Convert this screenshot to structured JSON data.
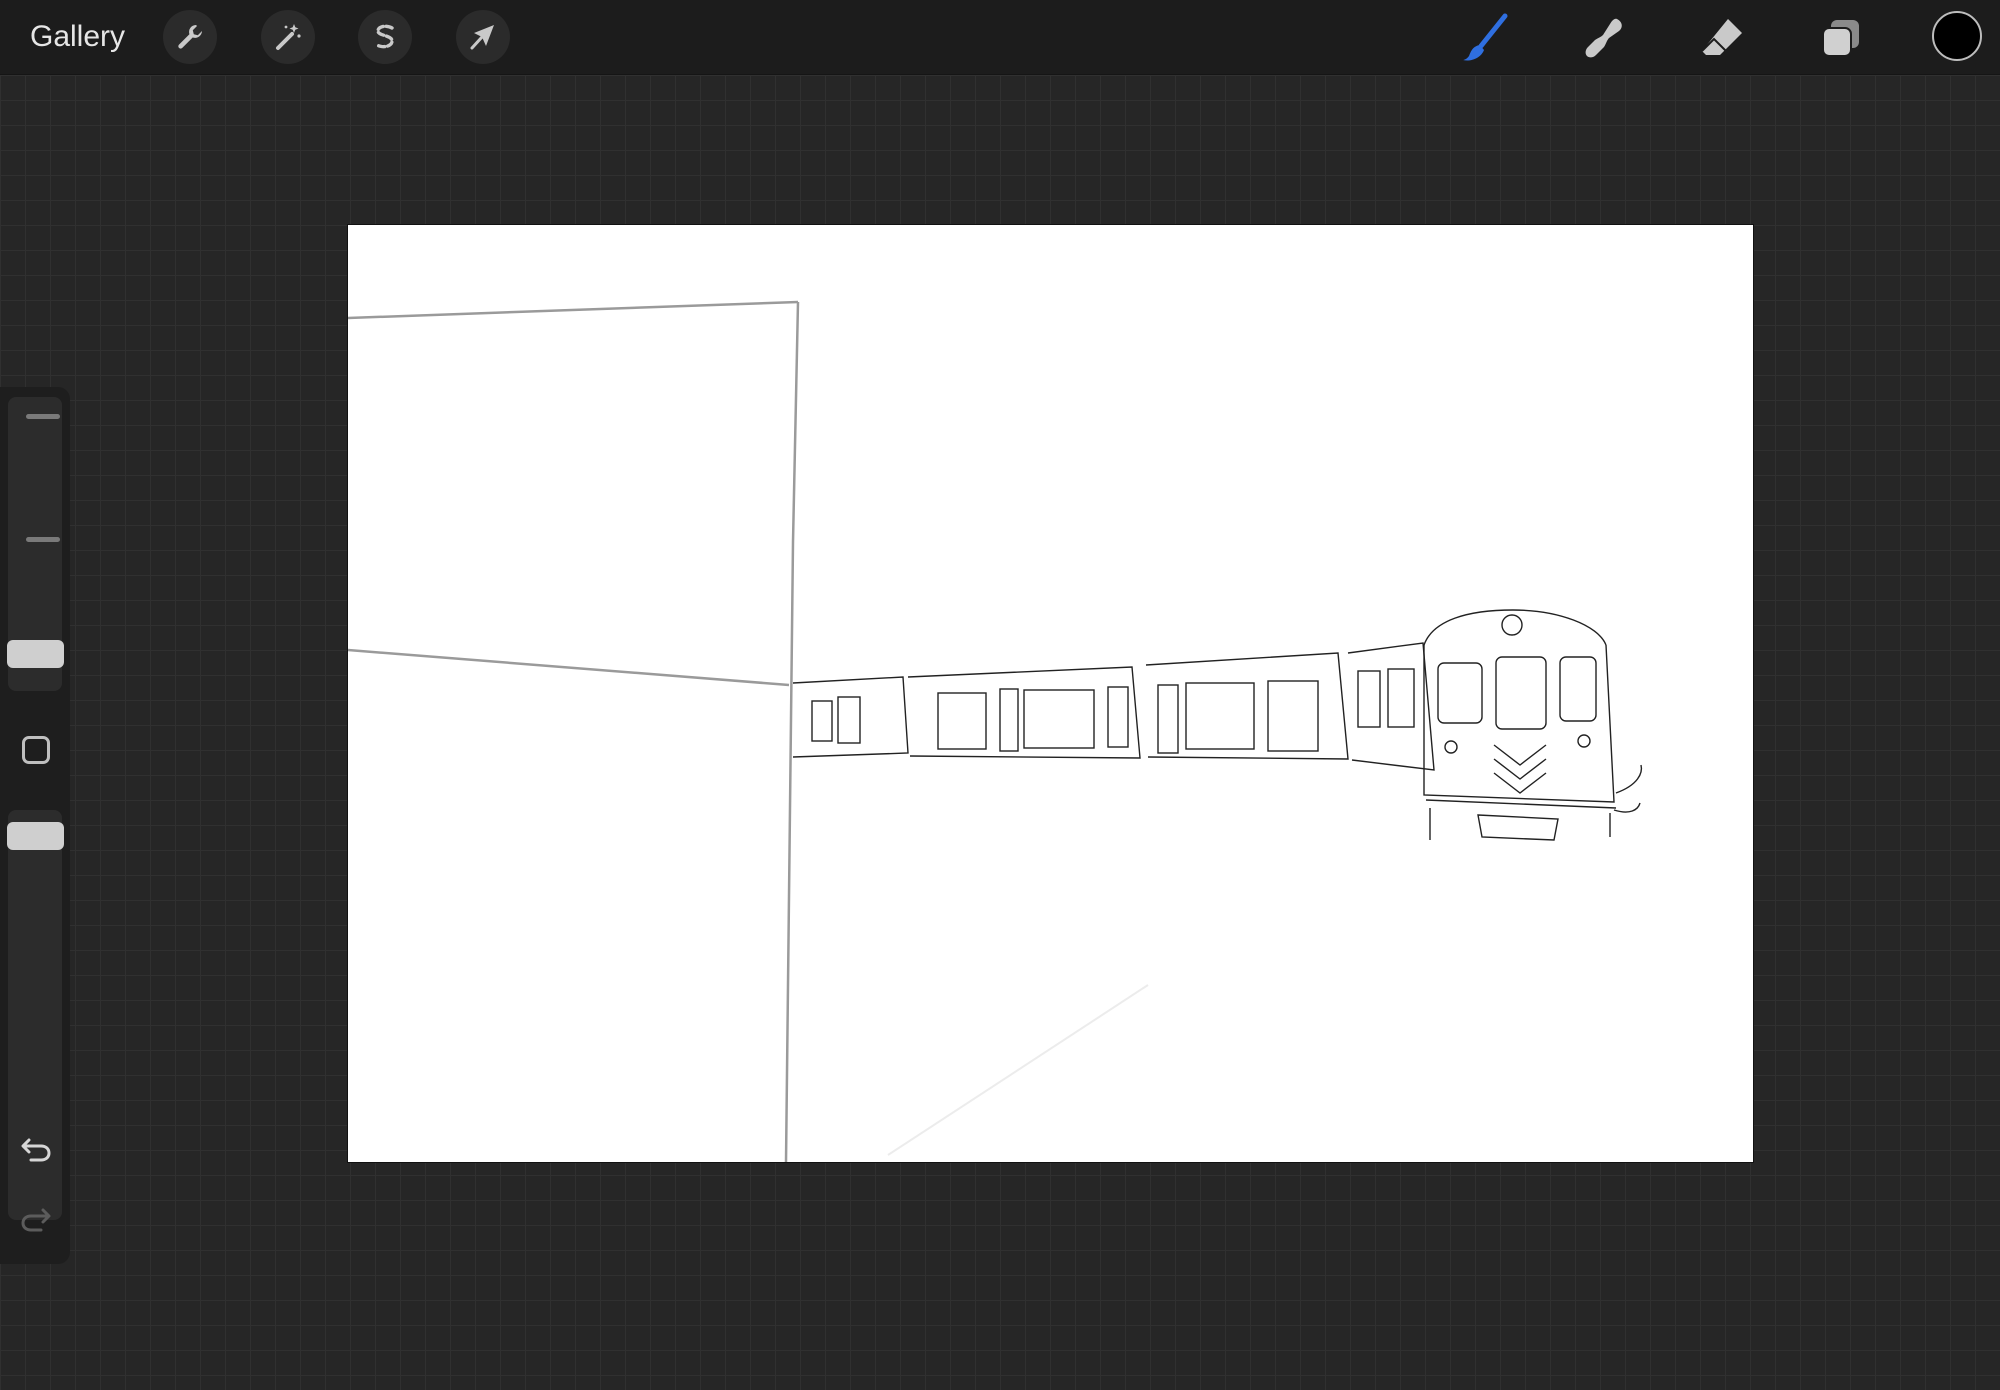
{
  "topbar": {
    "gallery_label": "Gallery",
    "left_tools": [
      {
        "name": "actions",
        "icon": "wrench-icon"
      },
      {
        "name": "adjustments",
        "icon": "magic-wand-icon"
      },
      {
        "name": "selection",
        "icon": "selection-s-icon"
      },
      {
        "name": "transform",
        "icon": "arrow-cursor-icon"
      }
    ],
    "right_tools": [
      {
        "name": "brush",
        "icon": "brush-icon",
        "active": true
      },
      {
        "name": "smudge",
        "icon": "smudge-icon",
        "active": false
      },
      {
        "name": "eraser",
        "icon": "eraser-icon",
        "active": false
      },
      {
        "name": "layers",
        "icon": "layers-icon",
        "active": false
      }
    ],
    "active_color": "#000000"
  },
  "sidebar": {
    "brush_size_icon": "slider-icon",
    "opacity_icon": "slider-icon",
    "modify_icon": "square-icon",
    "undo_icon": "undo-icon",
    "redo_icon": "redo-icon"
  },
  "colors": {
    "accent": "#2f6fe0",
    "background": "#262626",
    "toolbar": "#1c1c1c",
    "canvas": "#ffffff"
  }
}
